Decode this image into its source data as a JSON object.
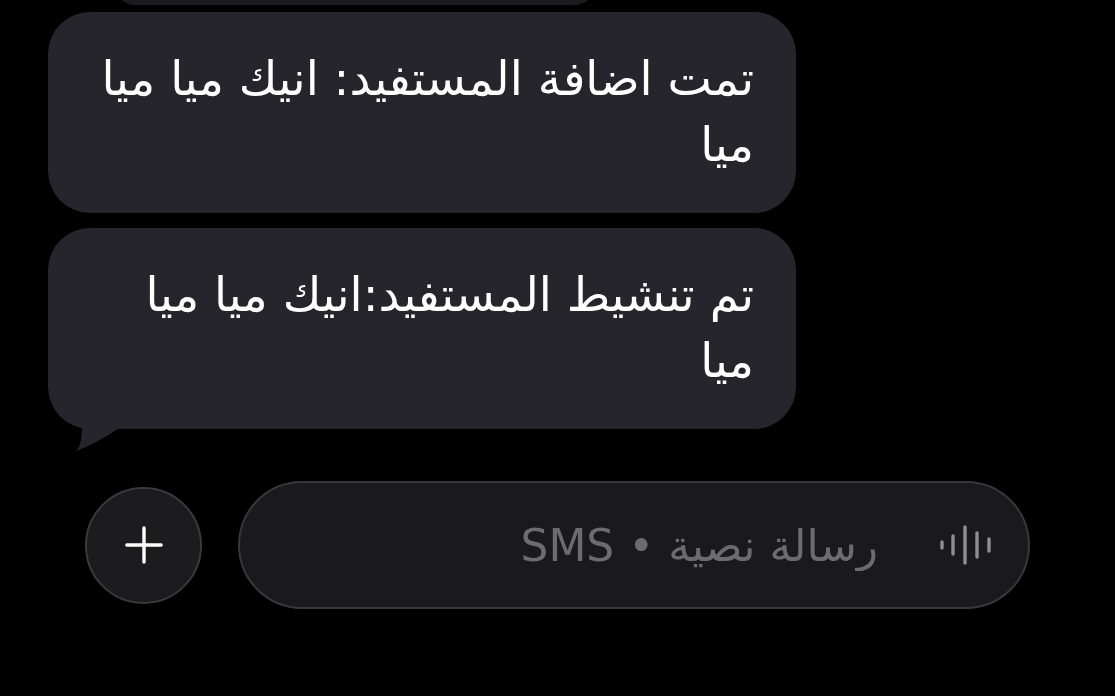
{
  "messages": [
    {
      "text": "تمت اضافة المستفيد: انيك ميا ميا ميا",
      "tail": false
    },
    {
      "text": "تم تنشيط المستفيد:انيك ميا ميا ميا",
      "tail": true
    }
  ],
  "composer": {
    "placeholder": "رسالة نصية • SMS"
  }
}
